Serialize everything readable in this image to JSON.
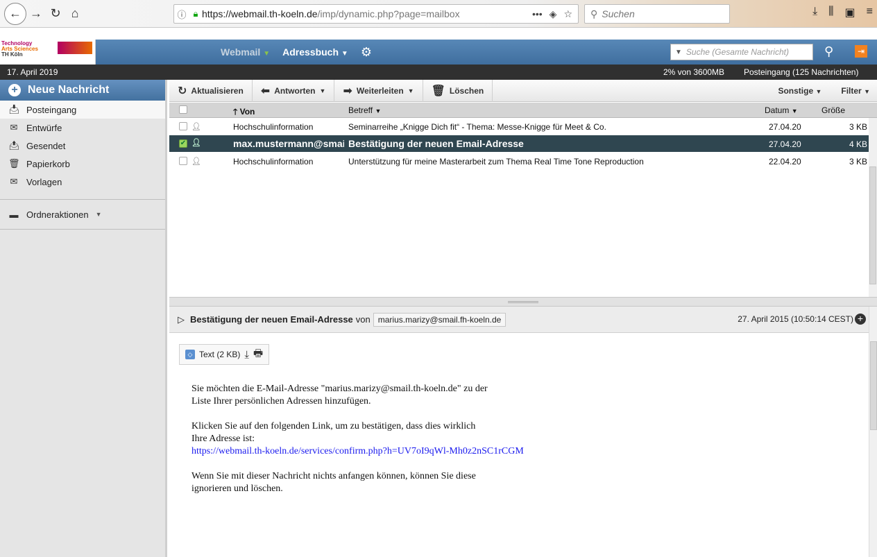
{
  "browser": {
    "url_host": "https://webmail.th-koeln.de",
    "url_path": "/imp/dynamic.php?page=mailbox",
    "search_placeholder": "Suchen"
  },
  "app": {
    "logo": [
      "Technology",
      "Arts Sciences",
      "TH Köln"
    ],
    "menu_webmail": "Webmail",
    "menu_addressbook": "Adressbuch",
    "search_placeholder": "Suche (Gesamte Nachricht)"
  },
  "infobar": {
    "date": "17. April 2019",
    "quota": "2% von 3600MB",
    "folder_info": "Posteingang (125 Nachrichten)"
  },
  "sidebar": {
    "new_message": "Neue Nachricht",
    "folders": [
      {
        "label": "Posteingang",
        "icon": "inbox-icon"
      },
      {
        "label": "Entwürfe",
        "icon": "drafts-icon"
      },
      {
        "label": "Gesendet",
        "icon": "sent-icon"
      },
      {
        "label": "Papierkorb",
        "icon": "trash-icon"
      },
      {
        "label": "Vorlagen",
        "icon": "templates-icon"
      }
    ],
    "folder_actions": "Ordneraktionen"
  },
  "toolbar": {
    "refresh": "Aktualisieren",
    "reply": "Antworten",
    "forward": "Weiterleiten",
    "delete": "Löschen",
    "other": "Sonstige",
    "filter": "Filter"
  },
  "list": {
    "columns": {
      "from": "Von",
      "subject": "Betreff",
      "date": "Datum",
      "size": "Größe"
    },
    "rows": [
      {
        "from": "Hochschulinformation",
        "subject": "Seminarreihe „Knigge Dich fit“ - Thema: Messe-Knigge für Meet & Co.",
        "date": "27.04.20",
        "size": "3 KB",
        "selected": false
      },
      {
        "from": "max.mustermann@smail.th-koeln.de",
        "subject": "Bestätigung der neuen Email-Adresse",
        "date": "27.04.20",
        "size": "4 KB",
        "selected": true
      },
      {
        "from": "Hochschulinformation",
        "subject": "Unterstützung für meine Masterarbeit zum Thema Real Time Tone Reproduction",
        "date": "22.04.20",
        "size": "3 KB",
        "selected": false
      }
    ]
  },
  "preview": {
    "subject": "Bestätigung der neuen Email-Adresse",
    "from_label": "von",
    "sender": "marius.marizy@smail.fh-koeln.de",
    "date": "27. April 2015 (10:50:14 CEST)",
    "attachment": "Text (2 KB)",
    "body_p1_l1": "Sie möchten die E-Mail-Adresse \"marius.marizy@smail.th-koeln.de\" zu der",
    "body_p1_l2": "Liste Ihrer persönlichen Adressen hinzufügen.",
    "body_p2_l1": "Klicken Sie auf den folgenden Link, um zu bestätigen, dass dies wirklich",
    "body_p2_l2": "Ihre Adresse ist:",
    "body_link": "https://webmail.th-koeln.de/services/confirm.php?h=UV7oI9qWl-Mh0z2nSC1rCGM",
    "body_p3_l1": "Wenn Sie mit dieser Nachricht nichts anfangen können, können Sie diese",
    "body_p3_l2": "ignorieren und löschen."
  }
}
